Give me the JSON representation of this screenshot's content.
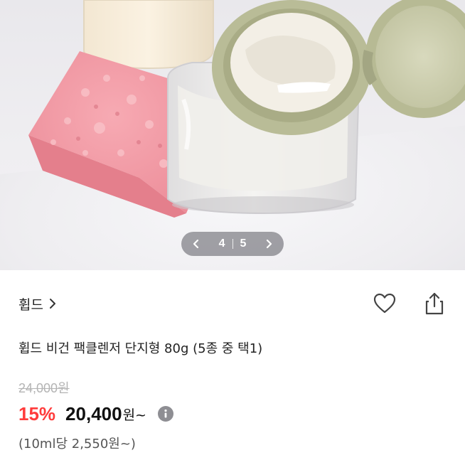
{
  "gallery": {
    "current_page": "4",
    "total_pages": "5",
    "prev_icon": "chevron-left-icon",
    "next_icon": "chevron-right-icon"
  },
  "brand": {
    "name": "휩드",
    "chevron_icon": "chevron-right-icon"
  },
  "actions": {
    "like_icon": "heart-icon",
    "share_icon": "share-icon"
  },
  "product": {
    "title": "휩드 비건 팩클렌저 단지형 80g (5종 중 택1)",
    "original_price": "24,000원",
    "discount": "15%",
    "price": "20,400",
    "price_unit": "원~",
    "info_icon": "info-icon",
    "unit_price": "(10ml당 2,550원~)"
  },
  "colors": {
    "discount_red": "#ff3b3b",
    "jar_lid_sage": "#b9bc97",
    "sponge_pink": "#f29aa4"
  }
}
